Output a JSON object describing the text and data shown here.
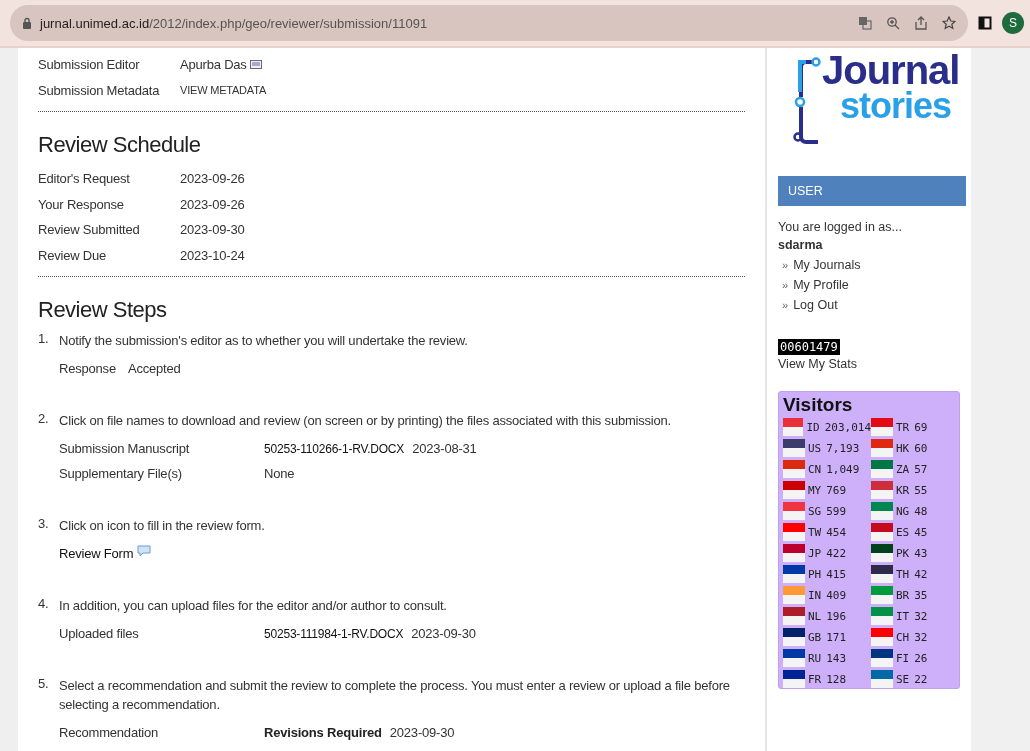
{
  "browser": {
    "url_host": "jurnal.unimed.ac.id",
    "url_path": "/2012/index.php/geo/reviewer/submission/11091",
    "profile_initial": "S"
  },
  "submission": [
    {
      "label": "Submission Editor",
      "value": "Apurba Das",
      "kind": "email"
    },
    {
      "label": "Submission Metadata",
      "value": "VIEW METADATA",
      "kind": "link"
    }
  ],
  "schedule": {
    "title": "Review Schedule",
    "rows": [
      {
        "label": "Editor's Request",
        "value": "2023-09-26"
      },
      {
        "label": "Your Response",
        "value": "2023-09-26"
      },
      {
        "label": "Review Submitted",
        "value": "2023-09-30"
      },
      {
        "label": "Review Due",
        "value": "2023-10-24"
      }
    ]
  },
  "steps": {
    "title": "Review Steps",
    "items": [
      {
        "number": "1.",
        "text": "Notify the submission's editor as to whether you will undertake the review.",
        "rows": [
          {
            "label": "Response",
            "kind": "inline",
            "value": "Accepted"
          }
        ]
      },
      {
        "number": "2.",
        "text": "Click on file names to download and review (on screen or by printing) the files associated with this submission.",
        "rows": [
          {
            "label": "Submission Manuscript",
            "kind": "file",
            "value": "50253-110266-1-RV.DOCX",
            "date": "2023-08-31"
          },
          {
            "label": "Supplementary File(s)",
            "kind": "text",
            "value": "None"
          }
        ]
      },
      {
        "number": "3.",
        "text": "Click on icon to fill in the review form.",
        "rows": [
          {
            "label": "Review Form",
            "kind": "form"
          }
        ]
      },
      {
        "number": "4.",
        "text": "In addition, you can upload files for the editor and/or author to consult.",
        "rows": [
          {
            "label": "Uploaded files",
            "kind": "file",
            "value": "50253-111984-1-RV.DOCX",
            "date": "2023-09-30"
          }
        ]
      },
      {
        "number": "5.",
        "text": "Select a recommendation and submit the review to complete the process. You must enter a review or upload a file before selecting a recommendation.",
        "rows": [
          {
            "label": "Recommendation",
            "kind": "strong",
            "value": "Revisions Required",
            "date": "2023-09-30"
          }
        ]
      }
    ]
  },
  "sidebar": {
    "logo_top": "Journal",
    "logo_bottom": "stories",
    "user_title": "USER",
    "logged_in": "You are logged in as...",
    "username": "sdarma",
    "links": [
      "My Journals",
      "My Profile",
      "Log Out"
    ],
    "bullet": "»",
    "counter": "00601479",
    "stats_link": "View My Stats",
    "visitors_title": "Visitors",
    "visitors": [
      {
        "code": "ID",
        "count": "203,014",
        "color": "#e8303a"
      },
      {
        "code": "TR",
        "count": "69",
        "color": "#e30a17"
      },
      {
        "code": "US",
        "count": "7,193",
        "color": "#3c3b6e"
      },
      {
        "code": "HK",
        "count": "60",
        "color": "#de2910"
      },
      {
        "code": "CN",
        "count": "1,049",
        "color": "#de2911"
      },
      {
        "code": "ZA",
        "count": "57",
        "color": "#007749"
      },
      {
        "code": "MY",
        "count": "769",
        "color": "#cc0001"
      },
      {
        "code": "KR",
        "count": "55",
        "color": "#cd2e3a"
      },
      {
        "code": "SG",
        "count": "599",
        "color": "#ef3340"
      },
      {
        "code": "NG",
        "count": "48",
        "color": "#008751"
      },
      {
        "code": "TW",
        "count": "454",
        "color": "#fe0000"
      },
      {
        "code": "ES",
        "count": "45",
        "color": "#c60b1e"
      },
      {
        "code": "JP",
        "count": "422",
        "color": "#bc002d"
      },
      {
        "code": "PK",
        "count": "43",
        "color": "#01411c"
      },
      {
        "code": "PH",
        "count": "415",
        "color": "#0038a8"
      },
      {
        "code": "TH",
        "count": "42",
        "color": "#2d2a4a"
      },
      {
        "code": "IN",
        "count": "409",
        "color": "#ff9933"
      },
      {
        "code": "BR",
        "count": "35",
        "color": "#009c3b"
      },
      {
        "code": "NL",
        "count": "196",
        "color": "#ae1c28"
      },
      {
        "code": "IT",
        "count": "32",
        "color": "#009246"
      },
      {
        "code": "GB",
        "count": "171",
        "color": "#012169"
      },
      {
        "code": "CH",
        "count": "32",
        "color": "#ff0000"
      },
      {
        "code": "RU",
        "count": "143",
        "color": "#0039a6"
      },
      {
        "code": "FI",
        "count": "26",
        "color": "#003580"
      },
      {
        "code": "FR",
        "count": "128",
        "color": "#002395"
      },
      {
        "code": "SE",
        "count": "22",
        "color": "#006aa7"
      }
    ]
  }
}
